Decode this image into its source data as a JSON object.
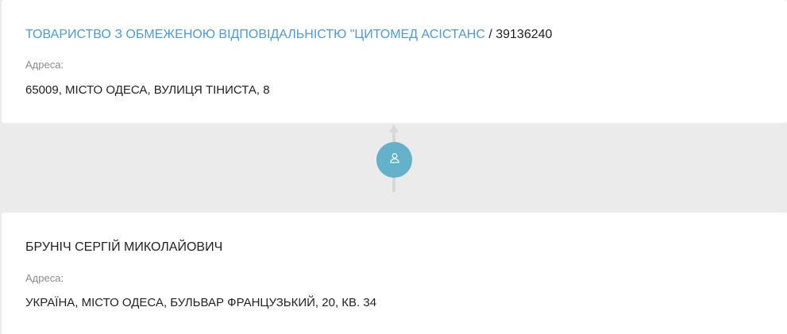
{
  "company": {
    "name": "ТОВАРИСТВО З ОБМЕЖЕНОЮ ВІДПОВІДАЛЬНІСТЮ \"ЦИТОМЕД АСІСТАНС",
    "separator": "/",
    "code": "39136240",
    "address_label": "Адреса:",
    "address": "65009, МІСТО ОДЕСА, ВУЛИЦЯ ТІНИСТА, 8"
  },
  "connector": {
    "icon": "user-icon",
    "color": "#64b2c9"
  },
  "person": {
    "name": "БРУНІЧ СЕРГІЙ МИКОЛАЙОВИЧ",
    "address_label": "Адреса:",
    "address": "УКРАЇНА, МІСТО ОДЕСА, БУЛЬВАР ФРАНЦУЗЬКИЙ, 20, КВ. 34"
  },
  "colors": {
    "link": "#4a9bdb",
    "background": "#ebebeb",
    "label": "#8a8a8a",
    "text": "#222222"
  }
}
